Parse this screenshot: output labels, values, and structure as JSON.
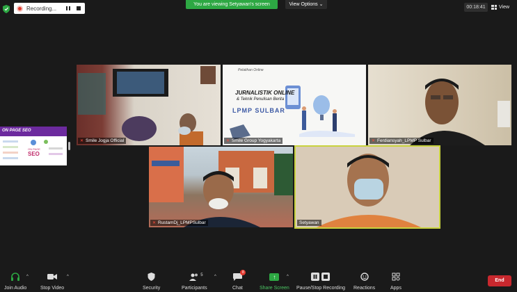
{
  "topbar": {
    "recording_label": "Recording...",
    "viewing_banner": "You are viewing Setyawan's screen",
    "view_options_label": "View Options",
    "timer": "00:18:41",
    "view_label": "View"
  },
  "tiles": [
    {
      "name": "Smile Jogja Official"
    },
    {
      "name": "Smile Group Yogyakarta"
    },
    {
      "name": "Ferdiansyah_LPMP Sulbar"
    },
    {
      "name": "RustamDj_LPMPSulbar"
    },
    {
      "name": "Setyawan"
    }
  ],
  "slides": {
    "left_band": "ON PAGE SEO",
    "left_small": "ON PAGE",
    "left_big": "SEO",
    "center_small": "Pelatihan Online",
    "center_title1": "JURNALISTIK ONLINE",
    "center_title2": "& Teknik Penulisan Berita",
    "center_title3": "LPMP SULBAR"
  },
  "toolbar": {
    "join_audio": "Join Audio",
    "stop_video": "Stop Video",
    "security": "Security",
    "participants": "Participants",
    "participants_count": "5",
    "chat": "Chat",
    "chat_badge": "8",
    "share_screen": "Share Screen",
    "record": "Pause/Stop Recording",
    "reactions": "Reactions",
    "apps": "Apps",
    "end": "End"
  },
  "colors": {
    "share_green": "#2da843",
    "end_red": "#c8282e",
    "active_speaker": "#c9d33e"
  }
}
